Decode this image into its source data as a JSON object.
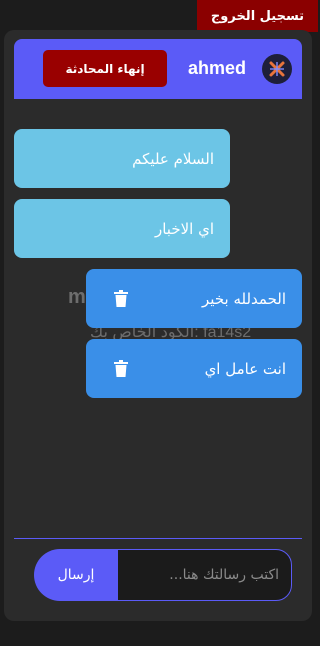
{
  "logout_label": "تسجيل الخروج",
  "header": {
    "username": "ahmed",
    "end_chat_label": "إنهاء المحادثة",
    "avatar_icon": "x-logo-icon"
  },
  "background_text": {
    "letter": "m",
    "code": "الكود الخاص بك: fa14s2"
  },
  "messages": [
    {
      "type": "incoming",
      "text": "السلام عليكم"
    },
    {
      "type": "incoming",
      "text": "اي الاخبار"
    },
    {
      "type": "outgoing",
      "text": "الحمدلله بخير",
      "icon": "trash-icon"
    },
    {
      "type": "outgoing",
      "text": "انت عامل اي",
      "icon": "trash-icon"
    }
  ],
  "composer": {
    "placeholder": "اكتب رسالتك هنا...",
    "send_label": "إرسال"
  },
  "colors": {
    "accent": "#5b5bf7",
    "danger": "#990000",
    "incoming_bubble": "#6cc5e6",
    "outgoing_bubble": "#3a8fe8"
  }
}
